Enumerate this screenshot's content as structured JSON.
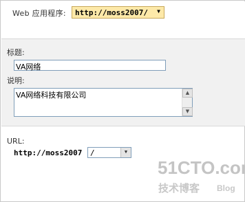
{
  "web_application": {
    "label": "Web 应用程序:",
    "selected": "http://moss2007/"
  },
  "title_field": {
    "label": "标题:",
    "value": "VA网络"
  },
  "description_field": {
    "label": "说明:",
    "value": "VA网络科技有限公司"
  },
  "url_field": {
    "label": "URL:",
    "prefix": "http://moss2007",
    "selected": "/"
  },
  "watermark": {
    "main": "51CTO.com",
    "sub": "技术博客",
    "blog": "Blog"
  },
  "icons": {
    "dropdown": "chevron-down-icon",
    "scroll_up": "scroll-up-arrow-icon",
    "scroll_down": "scroll-down-arrow-icon"
  },
  "colors": {
    "selector_bg": "#fde9a9",
    "form_bg": "#f1f1f1",
    "input_border": "#7f9db9",
    "watermark": "#c4c4c4"
  }
}
